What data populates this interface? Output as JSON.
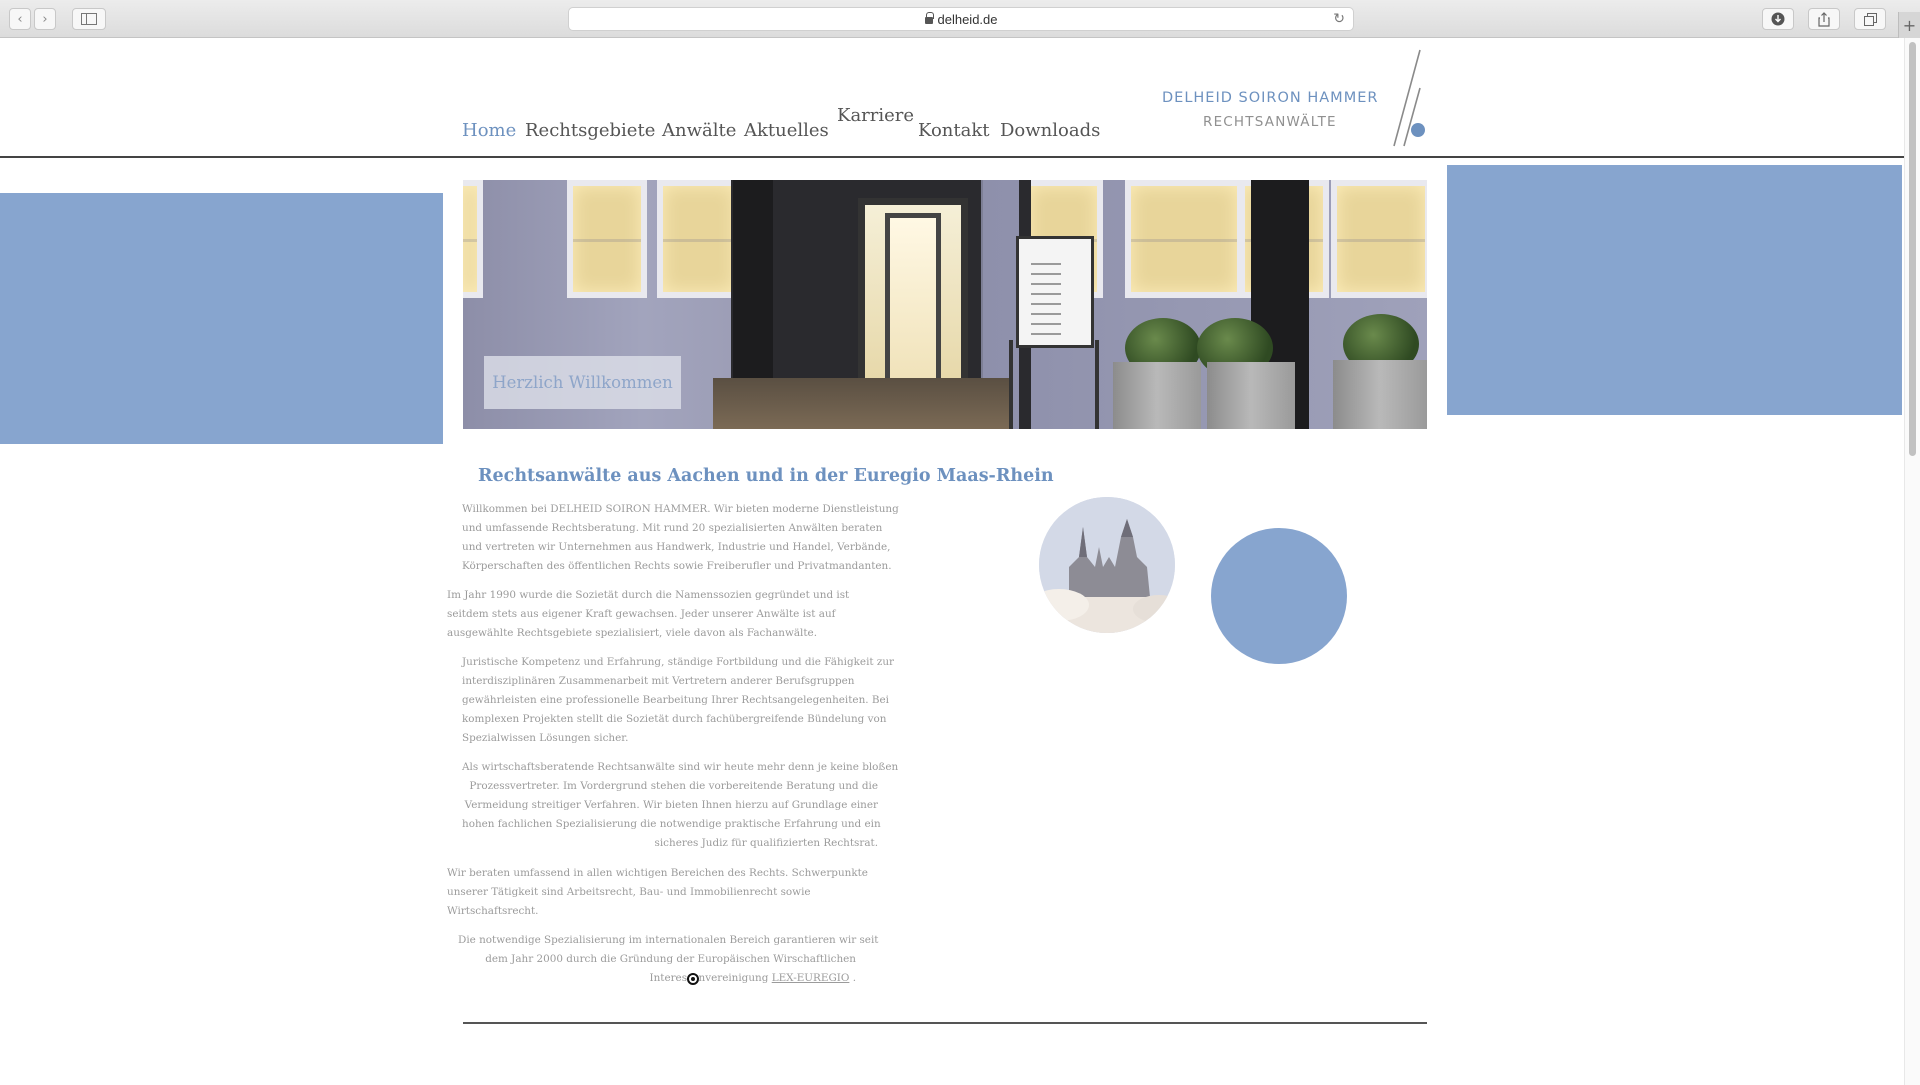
{
  "browser": {
    "url": "delheid.de",
    "back_icon": "chevron-left-icon",
    "forward_icon": "chevron-right-icon",
    "sidebar_icon": "sidebar-icon",
    "reload_icon": "reload-icon",
    "download_icon": "download-icon",
    "share_icon": "share-icon",
    "tabs_icon": "tabs-icon",
    "new_tab": "+"
  },
  "nav": {
    "items": [
      {
        "label": "Home",
        "active": true
      },
      {
        "label": "Rechtsgebiete"
      },
      {
        "label": "Anwälte"
      },
      {
        "label": "Aktuelles"
      },
      {
        "label": "Karriere"
      },
      {
        "label": "Kontakt"
      },
      {
        "label": "Downloads"
      }
    ]
  },
  "logo": {
    "line1": "DELHEID  SOIRON  HAMMER",
    "line2": "RECHTSANWÄLTE"
  },
  "hero": {
    "caption": "Herzlich Willkommen"
  },
  "content": {
    "headline": "Rechtsanwälte aus Aachen und in der Euregio Maas-Rhein",
    "p1": [
      "Willkommen bei DELHEID SOIRON HAMMER. Wir bieten moderne Dienstleistung",
      "und umfassende  Rechtsberatung. Mit rund 20 spezialisierten Anwälten beraten",
      "und vertreten wir Unternehmen aus Handwerk, Industrie und Handel, Verbände,",
      "Körperschaften des öffentlichen Rechts sowie Freiberufler und Privatmandanten."
    ],
    "p2": [
      "Im Jahr 1990 wurde die  Sozietät durch die Namenssozien gegründet und ist",
      "seitdem stets aus eigener Kraft gewachsen. Jeder unserer Anwälte ist auf",
      "ausgewählte Rechtsgebiete spezialisiert, viele davon als Fachanwälte."
    ],
    "p3": [
      "Juristische Kompetenz und Erfahrung, ständige Fortbildung und die Fähigkeit zur",
      "interdisziplinären Zusammenarbeit mit Vertretern anderer Berufsgruppen",
      "gewährleisten eine professionelle Bearbeitung Ihrer Rechtsangelegenheiten. Bei",
      "komplexen Projekten stellt die Sozietät durch fachübergreifende Bündelung von",
      "Spezialwissen Lösungen sicher."
    ],
    "p4": [
      "Als wirtschaftsberatende Rechtsanwälte sind wir heute mehr denn je keine bloßen",
      "Prozessvertreter. Im Vordergrund stehen die vorbereitende Beratung und die",
      "Vermeidung streitiger Verfahren. Wir bieten Ihnen hierzu auf Grundlage einer",
      "hohen fachlichen Spezialisierung die notwendige praktische Erfahrung und ein",
      "sicheres Judiz für qualifizierten Rechtsrat."
    ],
    "p5": [
      "Wir beraten umfassend in allen wichtigen Bereichen des Rechts. Schwerpunkte",
      "unserer Tätigkeit sind Arbeitsrecht, Bau- und Immobilienrecht sowie",
      "Wirtschaftsrecht."
    ],
    "p6": [
      "Die notwendige Spezialisierung im internationalen Bereich garantieren wir seit",
      "dem Jahr 2000 durch die Gründung der Europäischen Wirschaftlichen"
    ],
    "p6_last_prefix": "Interessenvereinigung ",
    "p6_link": "LEX-EUREGIO",
    "p6_last_suffix": " ."
  },
  "colors": {
    "accent": "#87a5cf",
    "link_active": "#6d91bf",
    "text_muted": "#9b9b9b"
  }
}
